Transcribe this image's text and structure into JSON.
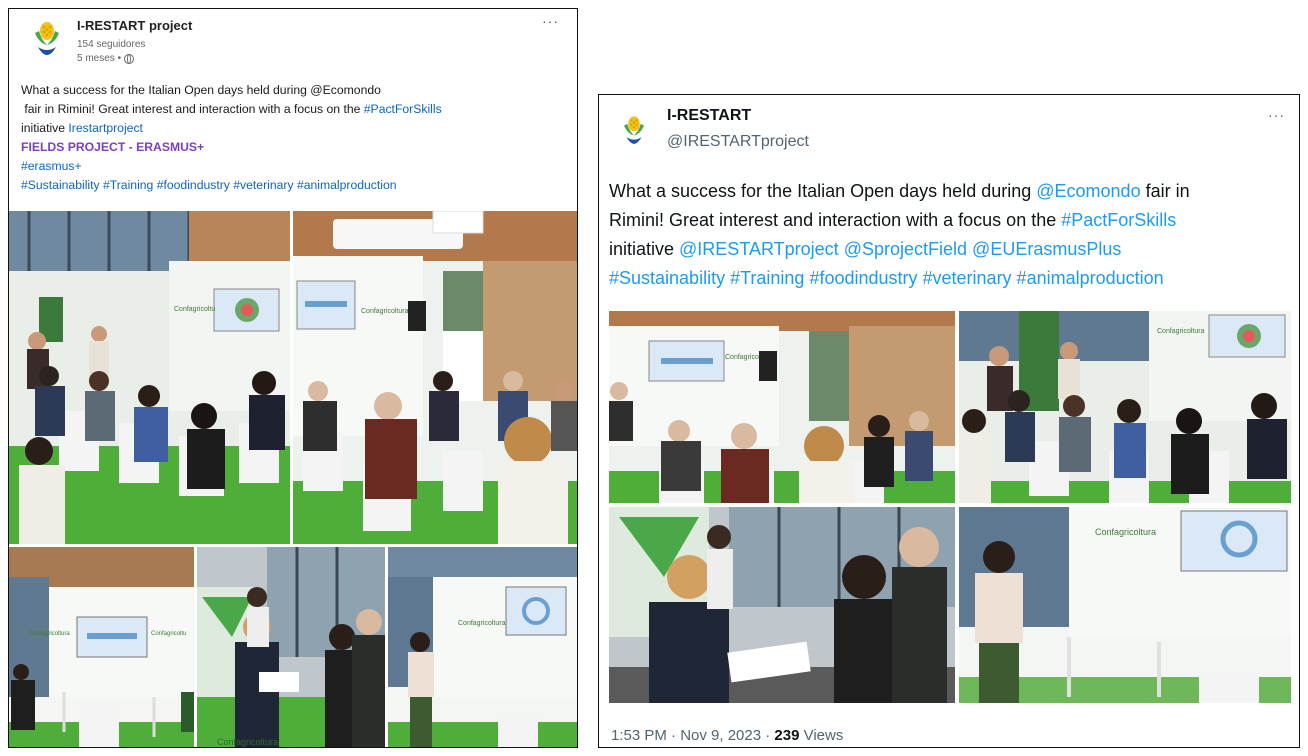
{
  "linkedin": {
    "author_name": "I-RESTART project",
    "followers": "154 seguidores",
    "time": "5 meses •",
    "more": "···",
    "line1": "What a success for the Italian Open days held during @Ecomondo",
    "line2_pre": "fair in Rimini! Great interest and interaction with a focus on the ",
    "line2_tag": "#PactForSkills",
    "line3_pre": "initiative ",
    "line3_link": "Irestartproject",
    "line4": "FIELDS PROJECT - ERASMUS+",
    "line5": "#erasmus+",
    "line6": "#Sustainability #Training #foodindustry #veterinary #animalproduction",
    "photos": {
      "brand_sign": "Confagricoltura",
      "brand_sign_short": "Confagricoltu",
      "booth_sign": "Confagricoltura",
      "foot_text": "Confagricoltura"
    }
  },
  "twitter": {
    "author_name": "I-RESTART",
    "handle": "@IRESTARTproject",
    "more": "···",
    "l1_pre": "What a success for the Italian Open days held during ",
    "l1_mention": "@Ecomondo",
    "l1_post": " fair in",
    "l2_pre": "Rimini! Great interest and interaction with a focus on the ",
    "l2_tag": "#PactForSkills",
    "l3_pre": "initiative ",
    "l3_m1": "@IRESTARTproject",
    "l3_m2": "@SprojectField",
    "l3_m3": "@EUErasmusPlus",
    "l4": "#Sustainability #Training #foodindustry #veterinary #animalproduction",
    "photos": {
      "brand_sign": "Confagricoltura",
      "booth_sign": "Confagricoltura"
    },
    "meta_time": "1:53 PM · Nov 9, 2023 · ",
    "meta_views_num": "239",
    "meta_views_label": " Views"
  },
  "colors": {
    "linkedin_blue": "#0a66c2",
    "twitter_blue": "#1d9bf0",
    "grass": "#4fae3a",
    "wall": "#eef2ee"
  }
}
